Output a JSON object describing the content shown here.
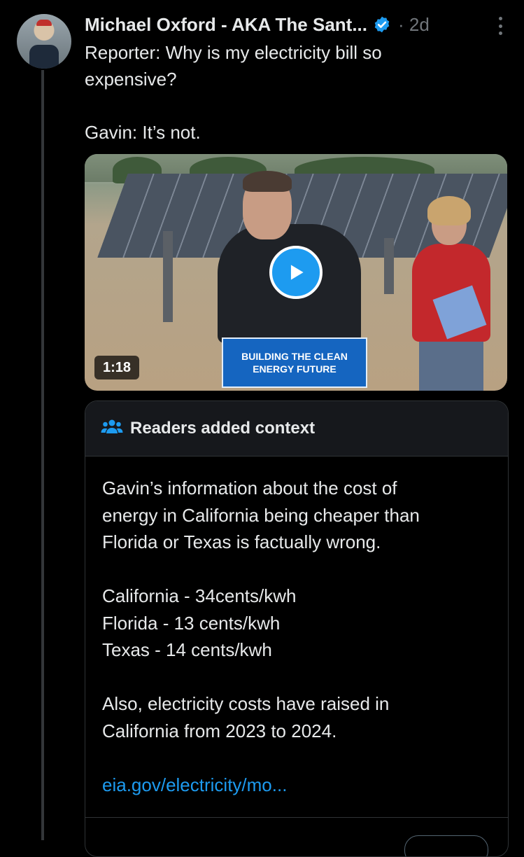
{
  "tweet": {
    "author_name": "Michael Oxford - AKA The Sant...",
    "time": "· 2d",
    "text_lines": [
      "Reporter: Why is my electricity bill so",
      "expensive?",
      "",
      "Gavin: It’s not."
    ]
  },
  "video": {
    "duration": "1:18",
    "podium_line1": "BUILDING THE CLEAN",
    "podium_line2": "ENERGY FUTURE"
  },
  "context": {
    "title": "Readers added context",
    "lines": [
      "Gavin’s information about the cost of",
      "energy in California being cheaper than",
      "Florida or Texas is factually wrong.",
      "",
      "California - 34cents/kwh",
      "Florida - 13 cents/kwh",
      "Texas - 14 cents/kwh",
      "",
      "Also, electricity costs have raised in",
      "California from 2023 to 2024.",
      ""
    ],
    "link": "eia.gov/electricity/mo..."
  },
  "colors": {
    "background": "#000000",
    "text": "#e7e9ea",
    "muted": "#71767b",
    "accent": "#1d9bf0",
    "card_header": "#16181c",
    "border": "#2f3336"
  },
  "icons": {
    "verified": "verified-badge-icon",
    "more": "more-vertical-icon",
    "play": "play-icon",
    "people": "people-group-icon"
  }
}
